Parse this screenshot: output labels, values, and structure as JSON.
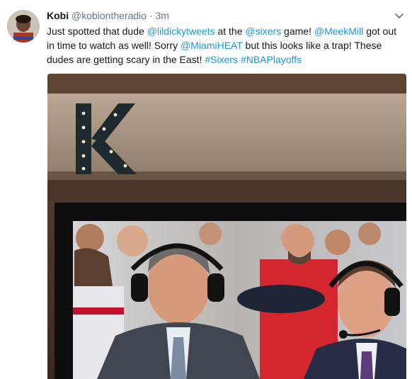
{
  "tweet": {
    "name": "Kobi",
    "handle": "@kobiontheradio",
    "separator": "·",
    "time": "3m",
    "text": {
      "s1": "Just spotted that dude ",
      "m1": "@lildickytweets",
      "s2": " at the ",
      "m2": "@sixers",
      "s3": " game! ",
      "m3": "@MeekMill",
      "s4": " got out in time to watch as well! Sorry ",
      "m4": "@MiamiHEAT",
      "s5": " but this looks like a trap! These dudes are getting scary in the East! ",
      "h1": "#Sixers",
      "s6": " ",
      "h2": "#NBAPlayoffs"
    },
    "sign_letter": "K"
  },
  "colors": {
    "link": "#1b95e0",
    "secondary": "#657786",
    "text": "#14171a"
  }
}
